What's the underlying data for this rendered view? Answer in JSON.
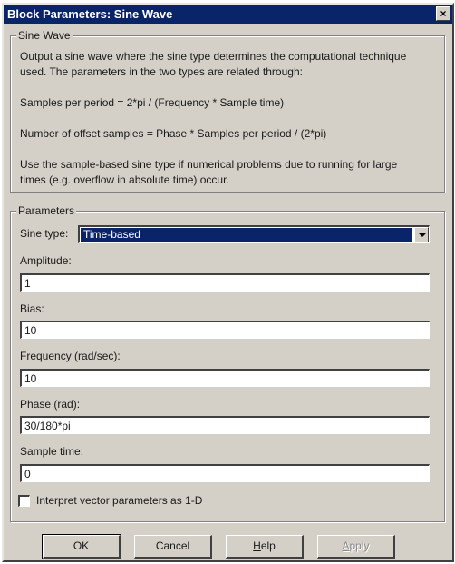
{
  "window": {
    "title": "Block Parameters: Sine Wave",
    "close_glyph": "×"
  },
  "sine_wave_group": {
    "legend": "Sine Wave",
    "description": [
      "Output a sine wave where the sine type determines the computational technique",
      "used. The parameters in the two types are related through:",
      "Samples per period = 2*pi / (Frequency * Sample time)",
      "Number of offset samples = Phase * Samples per period / (2*pi)",
      "Use the sample-based sine type if numerical problems due to running for large",
      "times (e.g. overflow in absolute time) occur."
    ]
  },
  "parameters_group": {
    "legend": "Parameters",
    "sine_type": {
      "label": "Sine type:",
      "value": "Time-based"
    },
    "amplitude": {
      "label": "Amplitude:",
      "value": "1"
    },
    "bias": {
      "label": "Bias:",
      "value": "10"
    },
    "frequency": {
      "label": "Frequency (rad/sec):",
      "value": "10"
    },
    "phase": {
      "label": "Phase (rad):",
      "value": "30/180*pi"
    },
    "sample_time": {
      "label": "Sample time:",
      "value": "0"
    },
    "interpret_checkbox": {
      "label": "Interpret vector parameters as 1-D",
      "checked": false
    }
  },
  "buttons": {
    "ok": "OK",
    "cancel": "Cancel",
    "help_accel": "H",
    "help_rest": "elp",
    "apply_accel": "A",
    "apply_rest": "pply"
  },
  "colors": {
    "titlebar": "#0a246a",
    "dialog_bg": "#d4d0c8",
    "selection": "#0a246a"
  },
  "icons": {
    "close": "close-icon",
    "dropdown": "chevron-down-icon"
  }
}
